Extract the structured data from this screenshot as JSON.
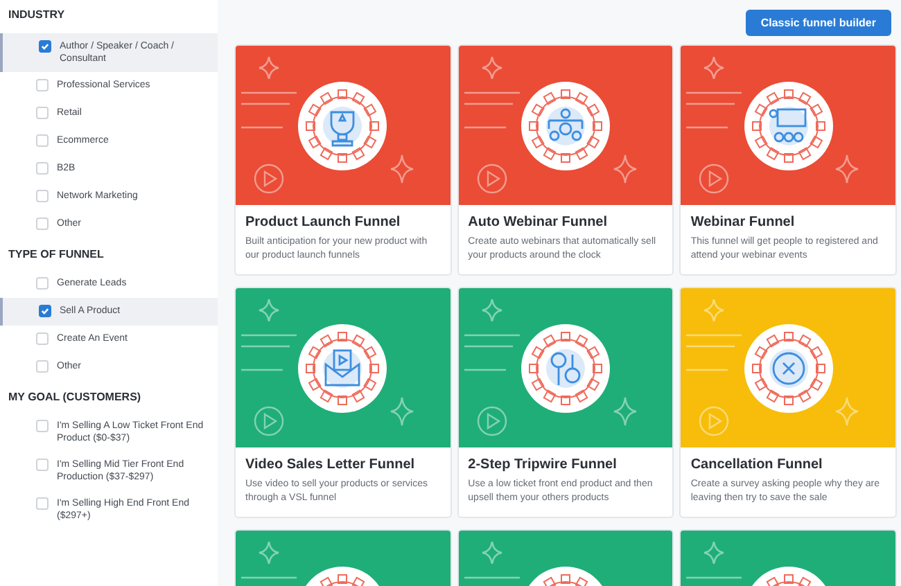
{
  "sidebar": {
    "sections": [
      {
        "title": "INDUSTRY",
        "options": [
          {
            "label": "Author / Speaker / Coach / Consultant",
            "checked": true
          },
          {
            "label": "Professional Services",
            "checked": false
          },
          {
            "label": "Retail",
            "checked": false
          },
          {
            "label": "Ecommerce",
            "checked": false
          },
          {
            "label": "B2B",
            "checked": false
          },
          {
            "label": "Network Marketing",
            "checked": false
          },
          {
            "label": "Other",
            "checked": false
          }
        ]
      },
      {
        "title": "TYPE OF FUNNEL",
        "options": [
          {
            "label": "Generate Leads",
            "checked": false
          },
          {
            "label": "Sell A Product",
            "checked": true
          },
          {
            "label": "Create An Event",
            "checked": false
          },
          {
            "label": "Other",
            "checked": false
          }
        ]
      },
      {
        "title": "MY GOAL (CUSTOMERS)",
        "options": [
          {
            "label": "I'm Selling A Low Ticket Front End Product ($0-$37)",
            "checked": false
          },
          {
            "label": "I'm Selling Mid Tier Front End Production ($37-$297)",
            "checked": false
          },
          {
            "label": "I'm Selling High End Front End ($297+)",
            "checked": false
          }
        ]
      }
    ]
  },
  "header": {
    "button": "Classic funnel builder"
  },
  "cards": [
    {
      "title": "Product Launch Funnel",
      "description": "Built anticipation for your new product with our product launch funnels",
      "color": "#ea4c36"
    },
    {
      "title": "Auto Webinar Funnel",
      "description": "Create auto webinars that automatically sell your products around the clock",
      "color": "#ea4c36"
    },
    {
      "title": "Webinar Funnel",
      "description": "This funnel will get people to registered and attend your webinar events",
      "color": "#ea4c36"
    },
    {
      "title": "Video Sales Letter Funnel",
      "description": "Use video to sell your products or services through a VSL funnel",
      "color": "#1fae78"
    },
    {
      "title": "2-Step Tripwire Funnel",
      "description": "Use a low ticket front end product and then upsell them your others products",
      "color": "#1fae78"
    },
    {
      "title": "Cancellation Funnel",
      "description": "Create a survey asking people why they are leaving then try to save the sale",
      "color": "#f7bd0a"
    },
    {
      "color": "#1fae78"
    },
    {
      "color": "#1fae78"
    },
    {
      "color": "#1fae78"
    }
  ]
}
